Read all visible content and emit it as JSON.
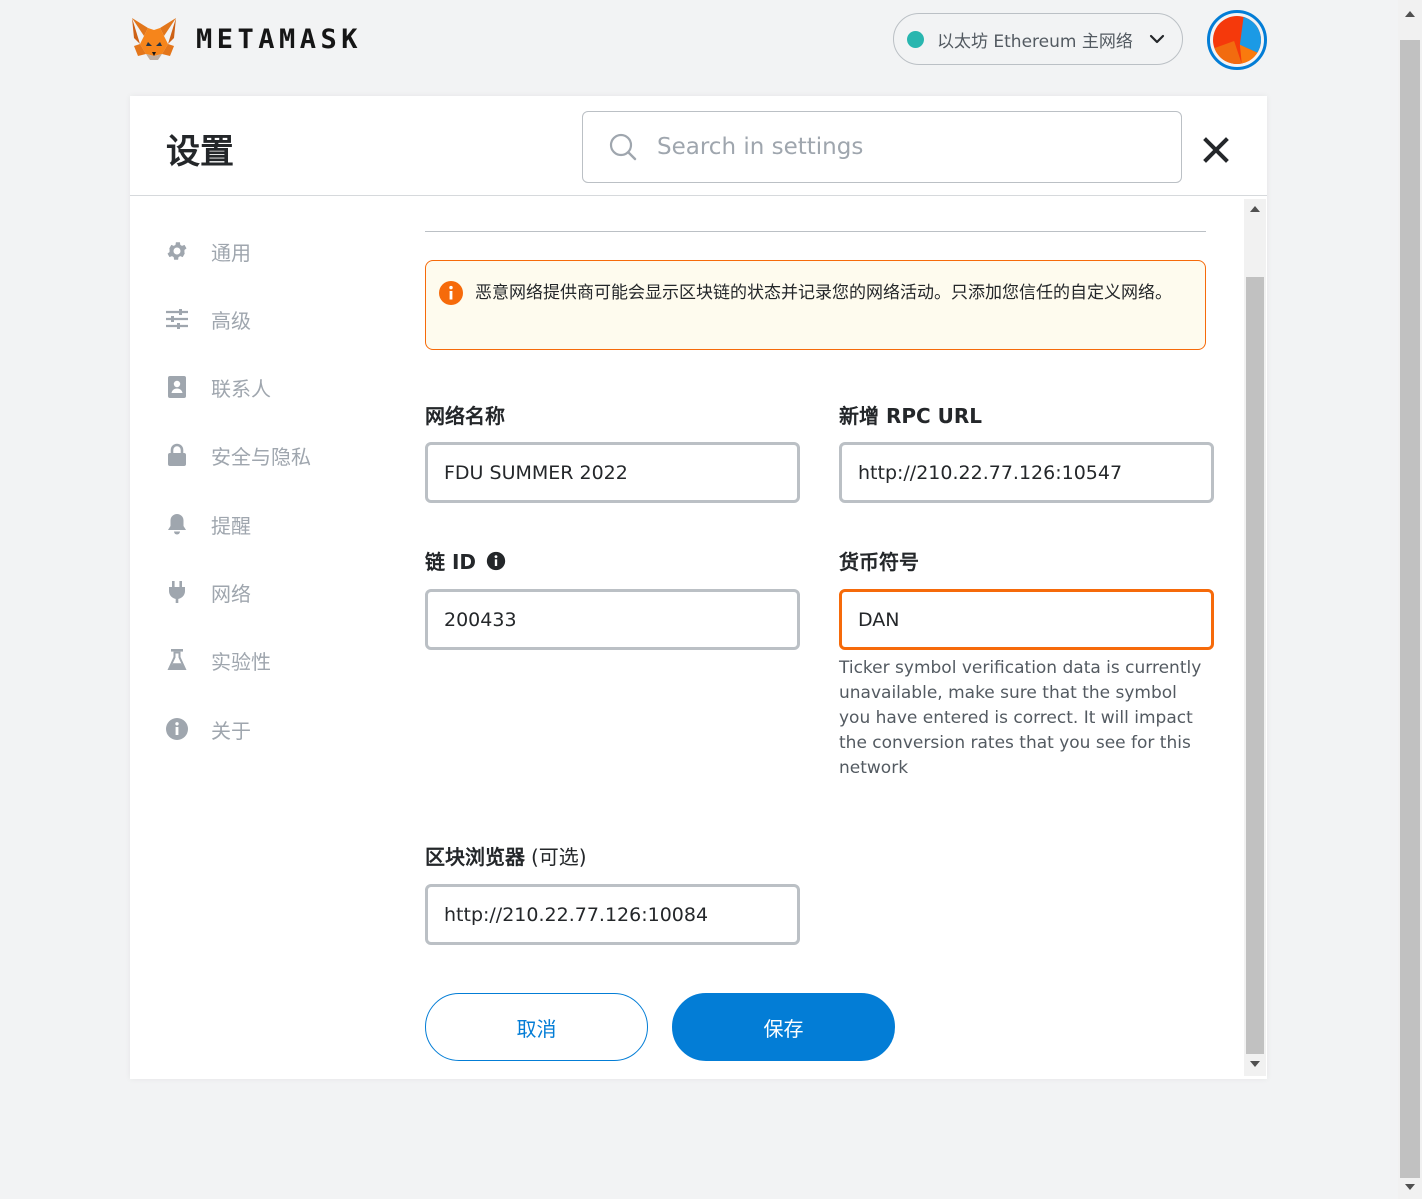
{
  "header": {
    "brand": "METAMASK",
    "network": {
      "label": "以太坊 Ethereum 主网络",
      "dot_color": "#29b6af"
    }
  },
  "settings": {
    "title": "设置",
    "search_placeholder": "Search in settings"
  },
  "sidebar": {
    "items": [
      {
        "label": "通用",
        "icon": "gear-icon"
      },
      {
        "label": "高级",
        "icon": "sliders-icon"
      },
      {
        "label": "联系人",
        "icon": "contact-book-icon"
      },
      {
        "label": "安全与隐私",
        "icon": "lock-icon"
      },
      {
        "label": "提醒",
        "icon": "bell-icon"
      },
      {
        "label": "网络",
        "icon": "plug-icon"
      },
      {
        "label": "实验性",
        "icon": "flask-icon"
      },
      {
        "label": "关于",
        "icon": "info-icon"
      }
    ]
  },
  "form": {
    "warning": "恶意网络提供商可能会显示区块链的状态并记录您的网络活动。只添加您信任的自定义网络。",
    "network_name": {
      "label": "网络名称",
      "value": "FDU SUMMER 2022"
    },
    "rpc_url": {
      "label": "新增 RPC URL",
      "value": "http://210.22.77.126:10547"
    },
    "chain_id": {
      "label": "链 ID",
      "value": "200433"
    },
    "currency_symbol": {
      "label": "货币符号",
      "value": "DAN",
      "hint": "Ticker symbol verification data is currently unavailable, make sure that the symbol you have entered is correct. It will impact the conversion rates that you see for this network"
    },
    "block_explorer": {
      "label": "区块浏览器",
      "optional": "(可选)",
      "value": "http://210.22.77.126:10084"
    },
    "cancel_label": "取消",
    "save_label": "保存"
  },
  "colors": {
    "accent": "#037dd6",
    "warning": "#f66a0a",
    "warning_bg": "#fefbee",
    "muted": "#9fa6ae"
  }
}
